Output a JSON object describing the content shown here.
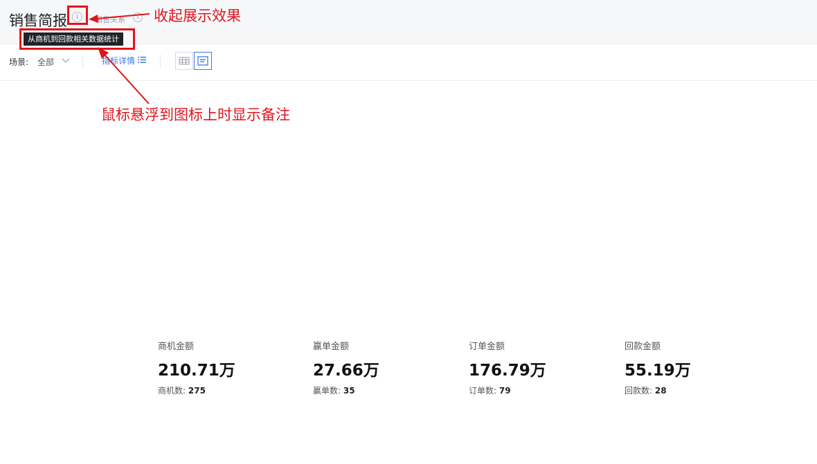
{
  "header": {
    "title": "销售简报",
    "sub_link": "销售关系",
    "tooltip": "从商机到回款相关数据统计"
  },
  "toolbar": {
    "scene_label": "场景:",
    "scene_value": "全部",
    "detail_link": "指标详情"
  },
  "annotations": {
    "collapse": "收起展示效果",
    "hover": "鼠标悬浮到图标上时显示备注"
  },
  "metrics": [
    {
      "label": "商机金额",
      "value": "210.71万",
      "count_label": "商机数:",
      "count": "275"
    },
    {
      "label": "赢单金额",
      "value": "27.66万",
      "count_label": "赢单数:",
      "count": "35"
    },
    {
      "label": "订单金额",
      "value": "176.79万",
      "count_label": "订单数:",
      "count": "79"
    },
    {
      "label": "回款金额",
      "value": "55.19万",
      "count_label": "回款数:",
      "count": "28"
    }
  ],
  "colors": {
    "accent": "#3b78e7",
    "annotation": "#e1141c",
    "tooltip_bg": "#1f2329"
  }
}
